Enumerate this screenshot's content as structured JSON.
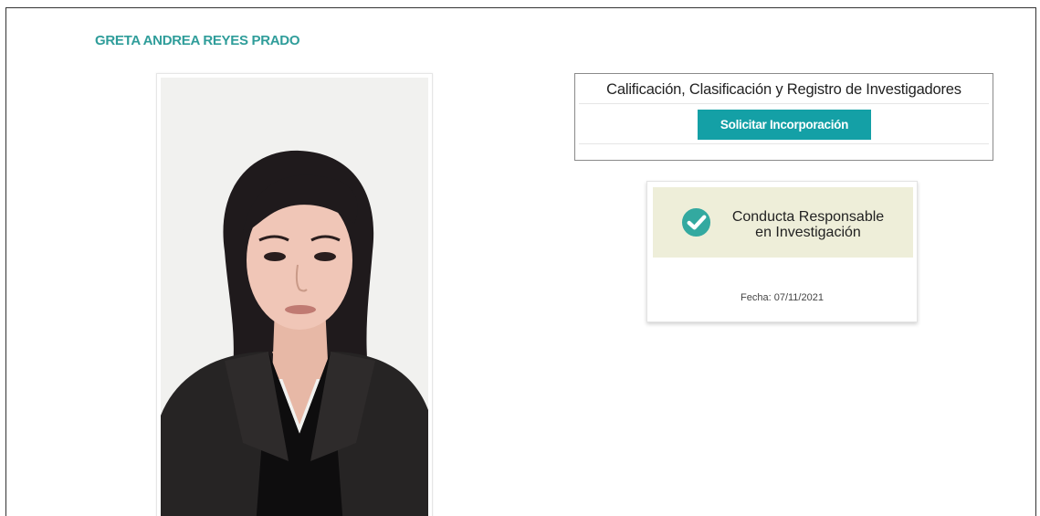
{
  "profile": {
    "name": "GRETA ANDREA REYES PRADO"
  },
  "credential_panel": {
    "title": "Calificación, Clasificación y Registro de Investigadores",
    "button_label": "Solicitar Incorporación"
  },
  "badge": {
    "line1": "Conducta Responsable",
    "line2": "en Investigación",
    "date": "Fecha: 07/11/2021",
    "icon": "check-circle-icon"
  },
  "colors": {
    "name_accent": "#2f9d9a",
    "button_bg": "#14a0a6",
    "badge_bg": "#eeeed9",
    "check_icon": "#33a9a0"
  }
}
